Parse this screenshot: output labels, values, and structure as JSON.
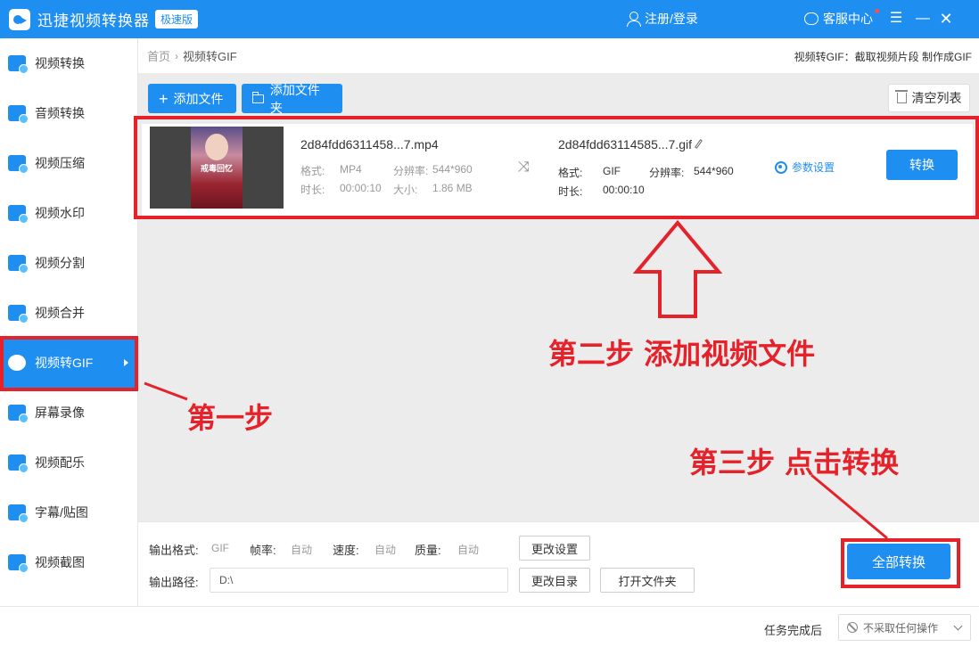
{
  "titlebar": {
    "app_name": "迅捷视频转换器",
    "edition": "极速版",
    "login": "注册/登录",
    "service": "客服中心",
    "menu_icon": "☰",
    "minimize_icon": "—",
    "close_icon": "✕"
  },
  "sidebar": {
    "items": [
      {
        "label": "视频转换"
      },
      {
        "label": "音频转换"
      },
      {
        "label": "视频压缩"
      },
      {
        "label": "视频水印"
      },
      {
        "label": "视频分割"
      },
      {
        "label": "视频合并"
      },
      {
        "label": "视频转GIF",
        "active": true
      },
      {
        "label": "屏幕录像"
      },
      {
        "label": "视频配乐"
      },
      {
        "label": "字幕/贴图"
      },
      {
        "label": "视频截图"
      }
    ]
  },
  "breadcrumb": {
    "home": "首页",
    "separator": "›",
    "current": "视频转GIF",
    "description": "视频转GIF：截取视频片段 制作成GIF"
  },
  "toolbar": {
    "add_file": "添加文件",
    "add_folder": "添加文件夹",
    "clear_list": "清空列表"
  },
  "file": {
    "thumbnail_text": "戒毒回忆",
    "source": {
      "name": "2d84fdd6311458...7.mp4",
      "format_label": "格式:",
      "format": "MP4",
      "resolution_label": "分辨率:",
      "resolution": "544*960",
      "duration_label": "时长:",
      "duration": "00:00:10",
      "size_label": "大小:",
      "size": "1.86 MB"
    },
    "output": {
      "name": "2d84fdd63114585...7.gif",
      "format_label": "格式:",
      "format": "GIF",
      "resolution_label": "分辨率:",
      "resolution": "544*960",
      "duration_label": "时长:",
      "duration": "00:00:10"
    },
    "param_settings": "参数设置",
    "convert": "转换"
  },
  "annotations": {
    "step1": "第一步",
    "step2": "第二步 添加视频文件",
    "step3": "第三步 点击转换",
    "color": "#e5212a"
  },
  "settings": {
    "format_label": "输出格式:",
    "format": "GIF",
    "fps_label": "帧率:",
    "fps": "自动",
    "speed_label": "速度:",
    "speed": "自动",
    "quality_label": "质量:",
    "quality": "自动",
    "change_settings": "更改设置",
    "path_label": "输出路径:",
    "path": "D:\\",
    "change_dir": "更改目录",
    "open_folder": "打开文件夹",
    "convert_all": "全部转换"
  },
  "footer": {
    "after_label": "任务完成后",
    "after_value": "不采取任何操作"
  },
  "colors": {
    "brand": "#1f8ef1",
    "annotation": "#e5212a"
  }
}
